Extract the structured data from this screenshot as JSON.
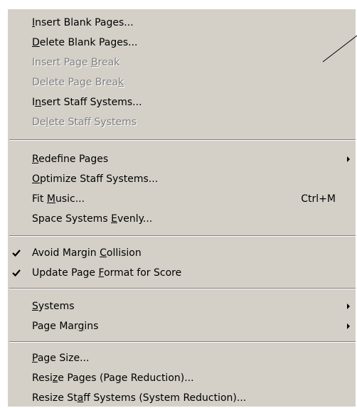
{
  "menu": {
    "items": [
      {
        "label_parts": [
          "",
          "I",
          "nsert Blank Pages..."
        ],
        "enabled": true
      },
      {
        "label_parts": [
          "",
          "D",
          "elete Blank Pages..."
        ],
        "enabled": true
      },
      {
        "label_parts": [
          "Insert Page ",
          "B",
          "reak"
        ],
        "enabled": false
      },
      {
        "label_parts": [
          "Delete Page Brea",
          "k",
          ""
        ],
        "enabled": false
      },
      {
        "label_parts": [
          "I",
          "n",
          "sert Staff Systems..."
        ],
        "enabled": true
      },
      {
        "label_parts": [
          "De",
          "l",
          "ete Staff Systems"
        ],
        "enabled": false
      },
      {
        "label_parts": [
          "",
          "R",
          "edefine Pages"
        ],
        "enabled": true,
        "submenu": true
      },
      {
        "label_parts": [
          "",
          "O",
          "ptimize Staff Systems..."
        ],
        "enabled": true
      },
      {
        "label_parts": [
          "Fit ",
          "M",
          "usic..."
        ],
        "enabled": true,
        "shortcut": "Ctrl+M"
      },
      {
        "label_parts": [
          "Space Systems ",
          "E",
          "venly..."
        ],
        "enabled": true
      },
      {
        "label_parts": [
          "Avoid Margin ",
          "C",
          "ollision"
        ],
        "enabled": true,
        "checked": true
      },
      {
        "label_parts": [
          "Update Page ",
          "F",
          "ormat for Score"
        ],
        "enabled": true,
        "checked": true
      },
      {
        "label_parts": [
          "",
          "S",
          "ystems"
        ],
        "enabled": true,
        "submenu": true
      },
      {
        "label_parts": [
          "Page Mar",
          "g",
          "ins"
        ],
        "enabled": true,
        "submenu": true
      },
      {
        "label_parts": [
          "",
          "P",
          "age Size..."
        ],
        "enabled": true
      },
      {
        "label_parts": [
          "Resi",
          "z",
          "e Pages (Page Reduction)..."
        ],
        "enabled": true
      },
      {
        "label_parts": [
          "Resize St",
          "a",
          "ff Systems (System Reduction)..."
        ],
        "enabled": true
      }
    ]
  }
}
